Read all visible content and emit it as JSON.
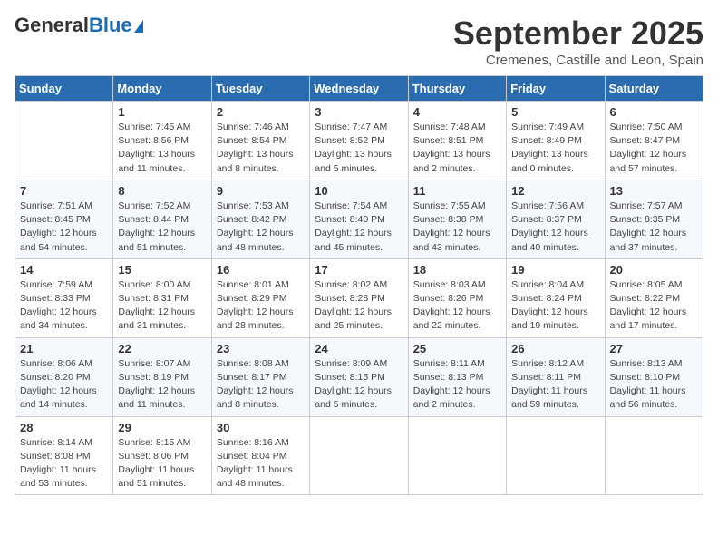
{
  "header": {
    "logo_general": "General",
    "logo_blue": "Blue",
    "month_title": "September 2025",
    "location": "Cremenes, Castille and Leon, Spain"
  },
  "weekdays": [
    "Sunday",
    "Monday",
    "Tuesday",
    "Wednesday",
    "Thursday",
    "Friday",
    "Saturday"
  ],
  "weeks": [
    [
      {
        "day": "",
        "sunrise": "",
        "sunset": "",
        "daylight": ""
      },
      {
        "day": "1",
        "sunrise": "Sunrise: 7:45 AM",
        "sunset": "Sunset: 8:56 PM",
        "daylight": "Daylight: 13 hours and 11 minutes."
      },
      {
        "day": "2",
        "sunrise": "Sunrise: 7:46 AM",
        "sunset": "Sunset: 8:54 PM",
        "daylight": "Daylight: 13 hours and 8 minutes."
      },
      {
        "day": "3",
        "sunrise": "Sunrise: 7:47 AM",
        "sunset": "Sunset: 8:52 PM",
        "daylight": "Daylight: 13 hours and 5 minutes."
      },
      {
        "day": "4",
        "sunrise": "Sunrise: 7:48 AM",
        "sunset": "Sunset: 8:51 PM",
        "daylight": "Daylight: 13 hours and 2 minutes."
      },
      {
        "day": "5",
        "sunrise": "Sunrise: 7:49 AM",
        "sunset": "Sunset: 8:49 PM",
        "daylight": "Daylight: 13 hours and 0 minutes."
      },
      {
        "day": "6",
        "sunrise": "Sunrise: 7:50 AM",
        "sunset": "Sunset: 8:47 PM",
        "daylight": "Daylight: 12 hours and 57 minutes."
      }
    ],
    [
      {
        "day": "7",
        "sunrise": "Sunrise: 7:51 AM",
        "sunset": "Sunset: 8:45 PM",
        "daylight": "Daylight: 12 hours and 54 minutes."
      },
      {
        "day": "8",
        "sunrise": "Sunrise: 7:52 AM",
        "sunset": "Sunset: 8:44 PM",
        "daylight": "Daylight: 12 hours and 51 minutes."
      },
      {
        "day": "9",
        "sunrise": "Sunrise: 7:53 AM",
        "sunset": "Sunset: 8:42 PM",
        "daylight": "Daylight: 12 hours and 48 minutes."
      },
      {
        "day": "10",
        "sunrise": "Sunrise: 7:54 AM",
        "sunset": "Sunset: 8:40 PM",
        "daylight": "Daylight: 12 hours and 45 minutes."
      },
      {
        "day": "11",
        "sunrise": "Sunrise: 7:55 AM",
        "sunset": "Sunset: 8:38 PM",
        "daylight": "Daylight: 12 hours and 43 minutes."
      },
      {
        "day": "12",
        "sunrise": "Sunrise: 7:56 AM",
        "sunset": "Sunset: 8:37 PM",
        "daylight": "Daylight: 12 hours and 40 minutes."
      },
      {
        "day": "13",
        "sunrise": "Sunrise: 7:57 AM",
        "sunset": "Sunset: 8:35 PM",
        "daylight": "Daylight: 12 hours and 37 minutes."
      }
    ],
    [
      {
        "day": "14",
        "sunrise": "Sunrise: 7:59 AM",
        "sunset": "Sunset: 8:33 PM",
        "daylight": "Daylight: 12 hours and 34 minutes."
      },
      {
        "day": "15",
        "sunrise": "Sunrise: 8:00 AM",
        "sunset": "Sunset: 8:31 PM",
        "daylight": "Daylight: 12 hours and 31 minutes."
      },
      {
        "day": "16",
        "sunrise": "Sunrise: 8:01 AM",
        "sunset": "Sunset: 8:29 PM",
        "daylight": "Daylight: 12 hours and 28 minutes."
      },
      {
        "day": "17",
        "sunrise": "Sunrise: 8:02 AM",
        "sunset": "Sunset: 8:28 PM",
        "daylight": "Daylight: 12 hours and 25 minutes."
      },
      {
        "day": "18",
        "sunrise": "Sunrise: 8:03 AM",
        "sunset": "Sunset: 8:26 PM",
        "daylight": "Daylight: 12 hours and 22 minutes."
      },
      {
        "day": "19",
        "sunrise": "Sunrise: 8:04 AM",
        "sunset": "Sunset: 8:24 PM",
        "daylight": "Daylight: 12 hours and 19 minutes."
      },
      {
        "day": "20",
        "sunrise": "Sunrise: 8:05 AM",
        "sunset": "Sunset: 8:22 PM",
        "daylight": "Daylight: 12 hours and 17 minutes."
      }
    ],
    [
      {
        "day": "21",
        "sunrise": "Sunrise: 8:06 AM",
        "sunset": "Sunset: 8:20 PM",
        "daylight": "Daylight: 12 hours and 14 minutes."
      },
      {
        "day": "22",
        "sunrise": "Sunrise: 8:07 AM",
        "sunset": "Sunset: 8:19 PM",
        "daylight": "Daylight: 12 hours and 11 minutes."
      },
      {
        "day": "23",
        "sunrise": "Sunrise: 8:08 AM",
        "sunset": "Sunset: 8:17 PM",
        "daylight": "Daylight: 12 hours and 8 minutes."
      },
      {
        "day": "24",
        "sunrise": "Sunrise: 8:09 AM",
        "sunset": "Sunset: 8:15 PM",
        "daylight": "Daylight: 12 hours and 5 minutes."
      },
      {
        "day": "25",
        "sunrise": "Sunrise: 8:11 AM",
        "sunset": "Sunset: 8:13 PM",
        "daylight": "Daylight: 12 hours and 2 minutes."
      },
      {
        "day": "26",
        "sunrise": "Sunrise: 8:12 AM",
        "sunset": "Sunset: 8:11 PM",
        "daylight": "Daylight: 11 hours and 59 minutes."
      },
      {
        "day": "27",
        "sunrise": "Sunrise: 8:13 AM",
        "sunset": "Sunset: 8:10 PM",
        "daylight": "Daylight: 11 hours and 56 minutes."
      }
    ],
    [
      {
        "day": "28",
        "sunrise": "Sunrise: 8:14 AM",
        "sunset": "Sunset: 8:08 PM",
        "daylight": "Daylight: 11 hours and 53 minutes."
      },
      {
        "day": "29",
        "sunrise": "Sunrise: 8:15 AM",
        "sunset": "Sunset: 8:06 PM",
        "daylight": "Daylight: 11 hours and 51 minutes."
      },
      {
        "day": "30",
        "sunrise": "Sunrise: 8:16 AM",
        "sunset": "Sunset: 8:04 PM",
        "daylight": "Daylight: 11 hours and 48 minutes."
      },
      {
        "day": "",
        "sunrise": "",
        "sunset": "",
        "daylight": ""
      },
      {
        "day": "",
        "sunrise": "",
        "sunset": "",
        "daylight": ""
      },
      {
        "day": "",
        "sunrise": "",
        "sunset": "",
        "daylight": ""
      },
      {
        "day": "",
        "sunrise": "",
        "sunset": "",
        "daylight": ""
      }
    ]
  ]
}
